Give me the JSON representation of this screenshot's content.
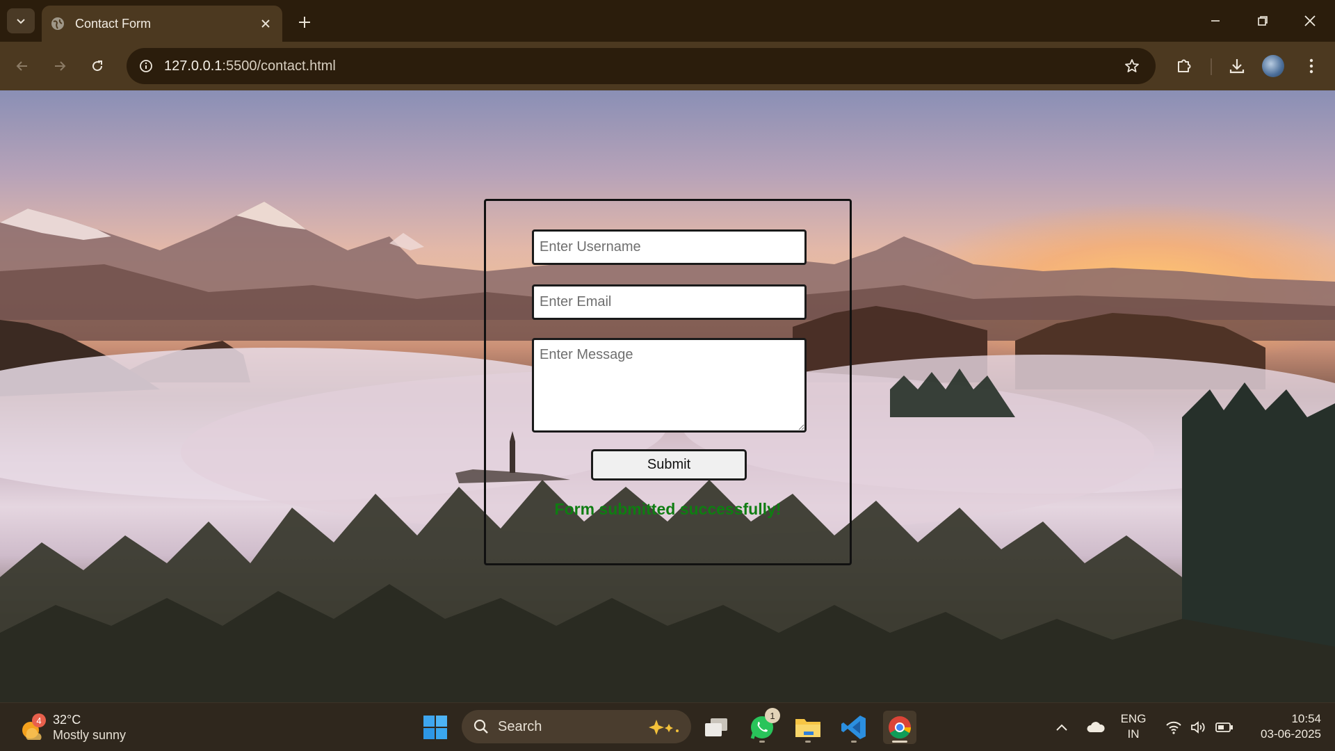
{
  "browser": {
    "tab_title": "Contact Form",
    "url_host": "127.0.0.1",
    "url_path": ":5500/contact.html"
  },
  "form": {
    "username_placeholder": "Enter Username",
    "email_placeholder": "Enter Email",
    "message_placeholder": "Enter Message",
    "submit_label": "Submit",
    "success_message": "Form submitted successfully!",
    "success_color": "#0f7d12"
  },
  "taskbar": {
    "weather_badge": "4",
    "weather_temp": "32°C",
    "weather_condition": "Mostly sunny",
    "search_label": "Search",
    "whatsapp_badge": "1",
    "lang_line1": "ENG",
    "lang_line2": "IN",
    "time": "10:54",
    "date": "03-06-2025"
  },
  "colors": {
    "chrome_bg": "#2b1d0c",
    "toolbar_bg": "#4c3920",
    "taskbar_bg": "#2f271d"
  }
}
